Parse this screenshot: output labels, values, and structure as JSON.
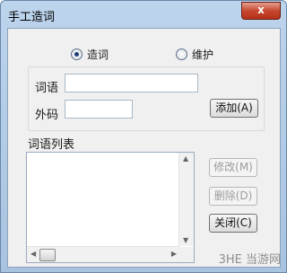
{
  "window": {
    "title": "手工造词",
    "close_label": "x"
  },
  "mode": {
    "options": [
      {
        "label": "造词",
        "selected": true
      },
      {
        "label": "维护",
        "selected": false
      }
    ]
  },
  "form": {
    "word_label": "词语",
    "word_value": "",
    "code_label": "外码",
    "code_value": "",
    "add_button": "添加(A)"
  },
  "list": {
    "label": "词语列表",
    "items": []
  },
  "actions": {
    "modify": "修改(M)",
    "delete": "删除(D)",
    "close": "关闭(C)"
  },
  "watermark": "3HE 当游网"
}
